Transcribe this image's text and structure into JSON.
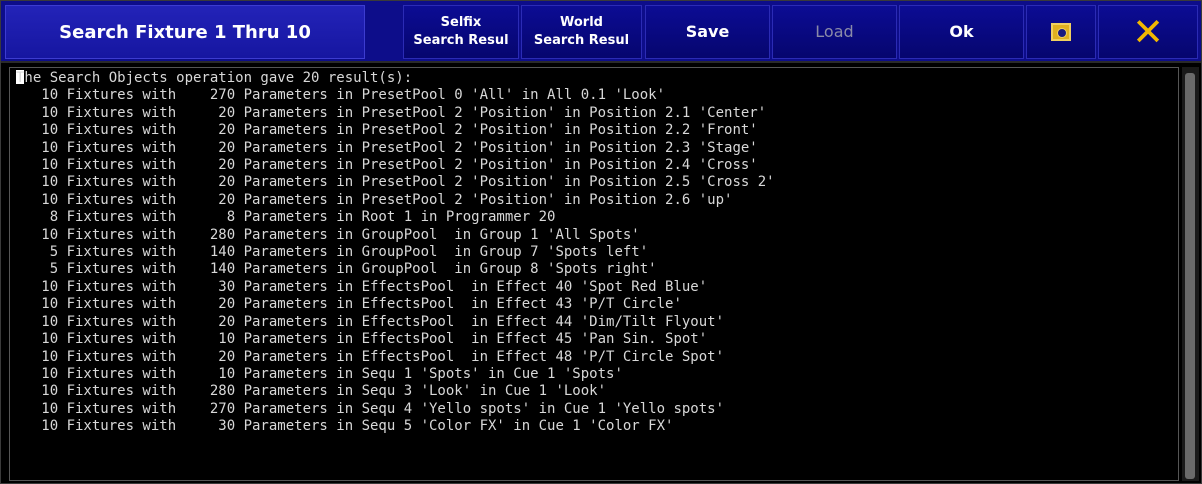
{
  "window": {
    "title": "Search Fixture 1 Thru 10"
  },
  "toolbar": {
    "selfix_line1": "Selfix",
    "selfix_line2": "Search Resul",
    "world_line1": "World",
    "world_line2": "Search Resul",
    "save_label": "Save",
    "load_label": "Load",
    "ok_label": "Ok",
    "camera_icon": "screenshot-icon",
    "close_icon": "close-icon",
    "close_glyph": "✕"
  },
  "colors": {
    "titlebar": "#0d0d8a",
    "close_icon": "#f2b800",
    "text": "#d8d8d8"
  },
  "output": {
    "lines": [
      "The Search Objects operation gave 20 result(s):",
      "   10 Fixtures with    270 Parameters in PresetPool 0 'All' in All 0.1 'Look'",
      "   10 Fixtures with     20 Parameters in PresetPool 2 'Position' in Position 2.1 'Center'",
      "   10 Fixtures with     20 Parameters in PresetPool 2 'Position' in Position 2.2 'Front'",
      "   10 Fixtures with     20 Parameters in PresetPool 2 'Position' in Position 2.3 'Stage'",
      "   10 Fixtures with     20 Parameters in PresetPool 2 'Position' in Position 2.4 'Cross'",
      "   10 Fixtures with     20 Parameters in PresetPool 2 'Position' in Position 2.5 'Cross 2'",
      "   10 Fixtures with     20 Parameters in PresetPool 2 'Position' in Position 2.6 'up'",
      "    8 Fixtures with      8 Parameters in Root 1 in Programmer 20",
      "   10 Fixtures with    280 Parameters in GroupPool  in Group 1 'All Spots'",
      "    5 Fixtures with    140 Parameters in GroupPool  in Group 7 'Spots left'",
      "    5 Fixtures with    140 Parameters in GroupPool  in Group 8 'Spots right'",
      "   10 Fixtures with     30 Parameters in EffectsPool  in Effect 40 'Spot Red Blue'",
      "   10 Fixtures with     20 Parameters in EffectsPool  in Effect 43 'P/T Circle'",
      "   10 Fixtures with     20 Parameters in EffectsPool  in Effect 44 'Dim/Tilt Flyout'",
      "   10 Fixtures with     10 Parameters in EffectsPool  in Effect 45 'Pan Sin. Spot'",
      "   10 Fixtures with     20 Parameters in EffectsPool  in Effect 48 'P/T Circle Spot'",
      "   10 Fixtures with     10 Parameters in Sequ 1 'Spots' in Cue 1 'Spots'",
      "   10 Fixtures with    280 Parameters in Sequ 3 'Look' in Cue 1 'Look'",
      "   10 Fixtures with    270 Parameters in Sequ 4 'Yello spots' in Cue 1 'Yello spots'",
      "   10 Fixtures with     30 Parameters in Sequ 5 'Color FX' in Cue 1 'Color FX'"
    ]
  }
}
